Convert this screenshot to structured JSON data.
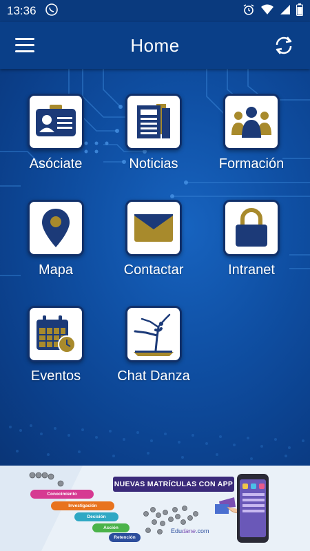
{
  "status_bar": {
    "time": "13:36",
    "icons": [
      "whatsapp-icon",
      "alarm-icon",
      "wifi-icon",
      "signal-icon",
      "battery-icon"
    ]
  },
  "app_bar": {
    "title": "Home",
    "left_icon": "menu-icon",
    "right_icon": "refresh-icon"
  },
  "colors": {
    "primary": "#0a3f88",
    "icon_navy": "#1c3a78",
    "icon_gold": "#a88a2c",
    "tile_bg": "#ffffff"
  },
  "tiles": [
    {
      "label": "Asóciate",
      "icon": "member-card-icon"
    },
    {
      "label": "Noticias",
      "icon": "newspaper-icon"
    },
    {
      "label": "Formación",
      "icon": "group-icon"
    },
    {
      "label": "Mapa",
      "icon": "map-pin-icon"
    },
    {
      "label": "Contactar",
      "icon": "envelope-icon"
    },
    {
      "label": "Intranet",
      "icon": "lock-icon"
    },
    {
      "label": "Eventos",
      "icon": "calendar-clock-icon"
    },
    {
      "label": "Chat Danza",
      "icon": "dancer-icon"
    }
  ],
  "banner": {
    "headline": "NUEVAS MATRÍCULAS CON  APP",
    "stages": [
      "Conocimiento",
      "Investigación",
      "Decisión",
      "Acción",
      "Retención"
    ],
    "logo_prefix": "Edu",
    "logo_bold": "dane",
    "logo_suffix": ".com"
  }
}
